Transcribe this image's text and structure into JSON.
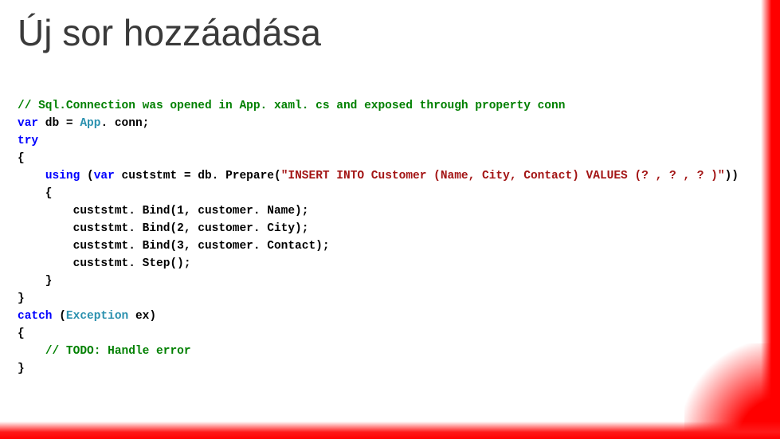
{
  "title": "Új sor hozzáadása",
  "code": {
    "l1": "// Sql.Connection was opened in App. xaml. cs and exposed through property conn",
    "l2a": "var",
    "l2b": " db = ",
    "l2c": "App",
    "l2d": ". conn;",
    "l3": "try",
    "l4": "{",
    "l5a": "    ",
    "l5b": "using",
    "l5c": " (",
    "l5d": "var",
    "l5e": " custstmt = db. Prepare(",
    "l5f": "\"INSERT INTO Customer (Name, City, Contact) VALUES (? , ? , ? )\"",
    "l5g": "))",
    "l6": "    {",
    "l7": "        custstmt. Bind(1, customer. Name);",
    "l8": "        custstmt. Bind(2, customer. City);",
    "l9": "        custstmt. Bind(3, customer. Contact);",
    "l10": "        custstmt. Step();",
    "l11": "    }",
    "l12": "}",
    "l13a": "catch",
    "l13b": " (",
    "l13c": "Exception",
    "l13d": " ex)",
    "l14": "{",
    "l15a": "    ",
    "l15b": "// TODO: Handle error",
    "l16": "}"
  }
}
